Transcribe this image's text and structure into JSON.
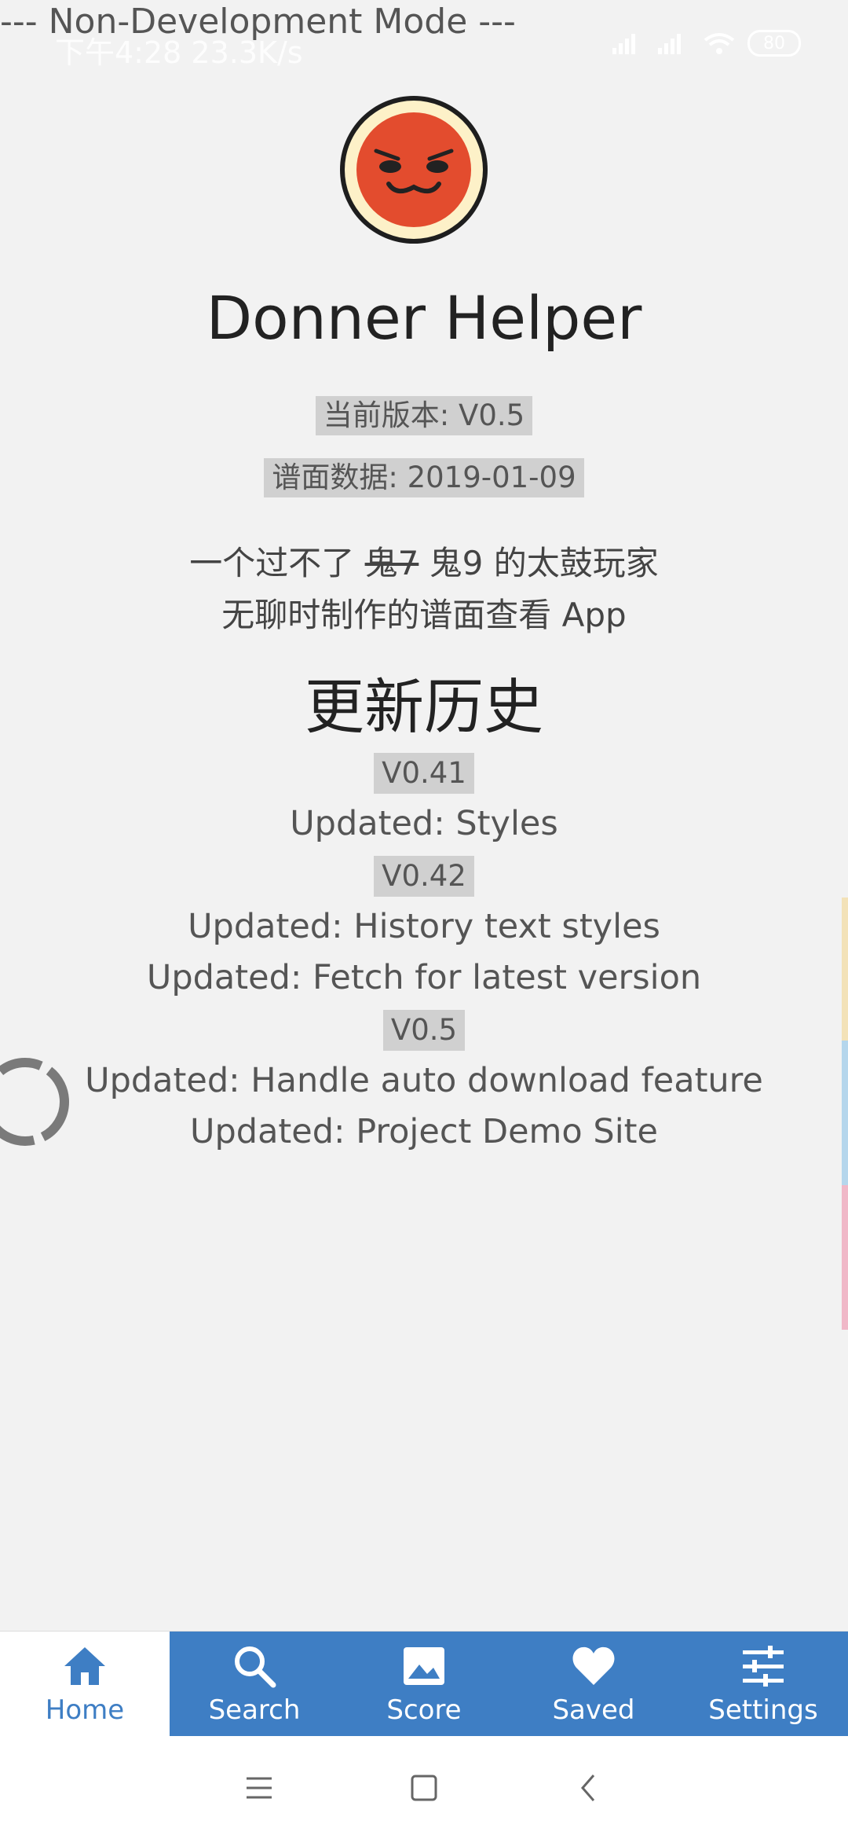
{
  "status": {
    "time": "下午4:28 23.3K/s",
    "battery": "80"
  },
  "dev_mode": "--- Non-Development Mode ---",
  "app": {
    "title": "Donner Helper",
    "version": "当前版本: V0.5",
    "data_date": "谱面数据: 2019-01-09",
    "tagline_prefix": "一个过不了 ",
    "tagline_strike": "鬼7",
    "tagline_rest": " 鬼9 的太鼓玩家",
    "tagline_line2": "无聊时制作的谱面查看 App"
  },
  "history": {
    "title": "更新历史",
    "versions": [
      {
        "label": "V0.41",
        "items": [
          "Updated: Styles"
        ]
      },
      {
        "label": "V0.42",
        "items": [
          "Updated: History text styles",
          "Updated: Fetch for latest version"
        ]
      },
      {
        "label": "V0.5",
        "items": [
          "Updated: Handle auto download feature",
          "Updated: Project Demo Site"
        ]
      }
    ]
  },
  "nav": {
    "items": [
      {
        "label": "Home",
        "icon": "home-icon"
      },
      {
        "label": "Search",
        "icon": "search-icon"
      },
      {
        "label": "Score",
        "icon": "image-icon"
      },
      {
        "label": "Saved",
        "icon": "heart-icon"
      },
      {
        "label": "Settings",
        "icon": "sliders-icon"
      }
    ]
  },
  "colors": {
    "accent": "#3e7ec4",
    "sidebar": [
      "#f3e2b8",
      "#b5d6ec",
      "#f0b8c8"
    ]
  }
}
